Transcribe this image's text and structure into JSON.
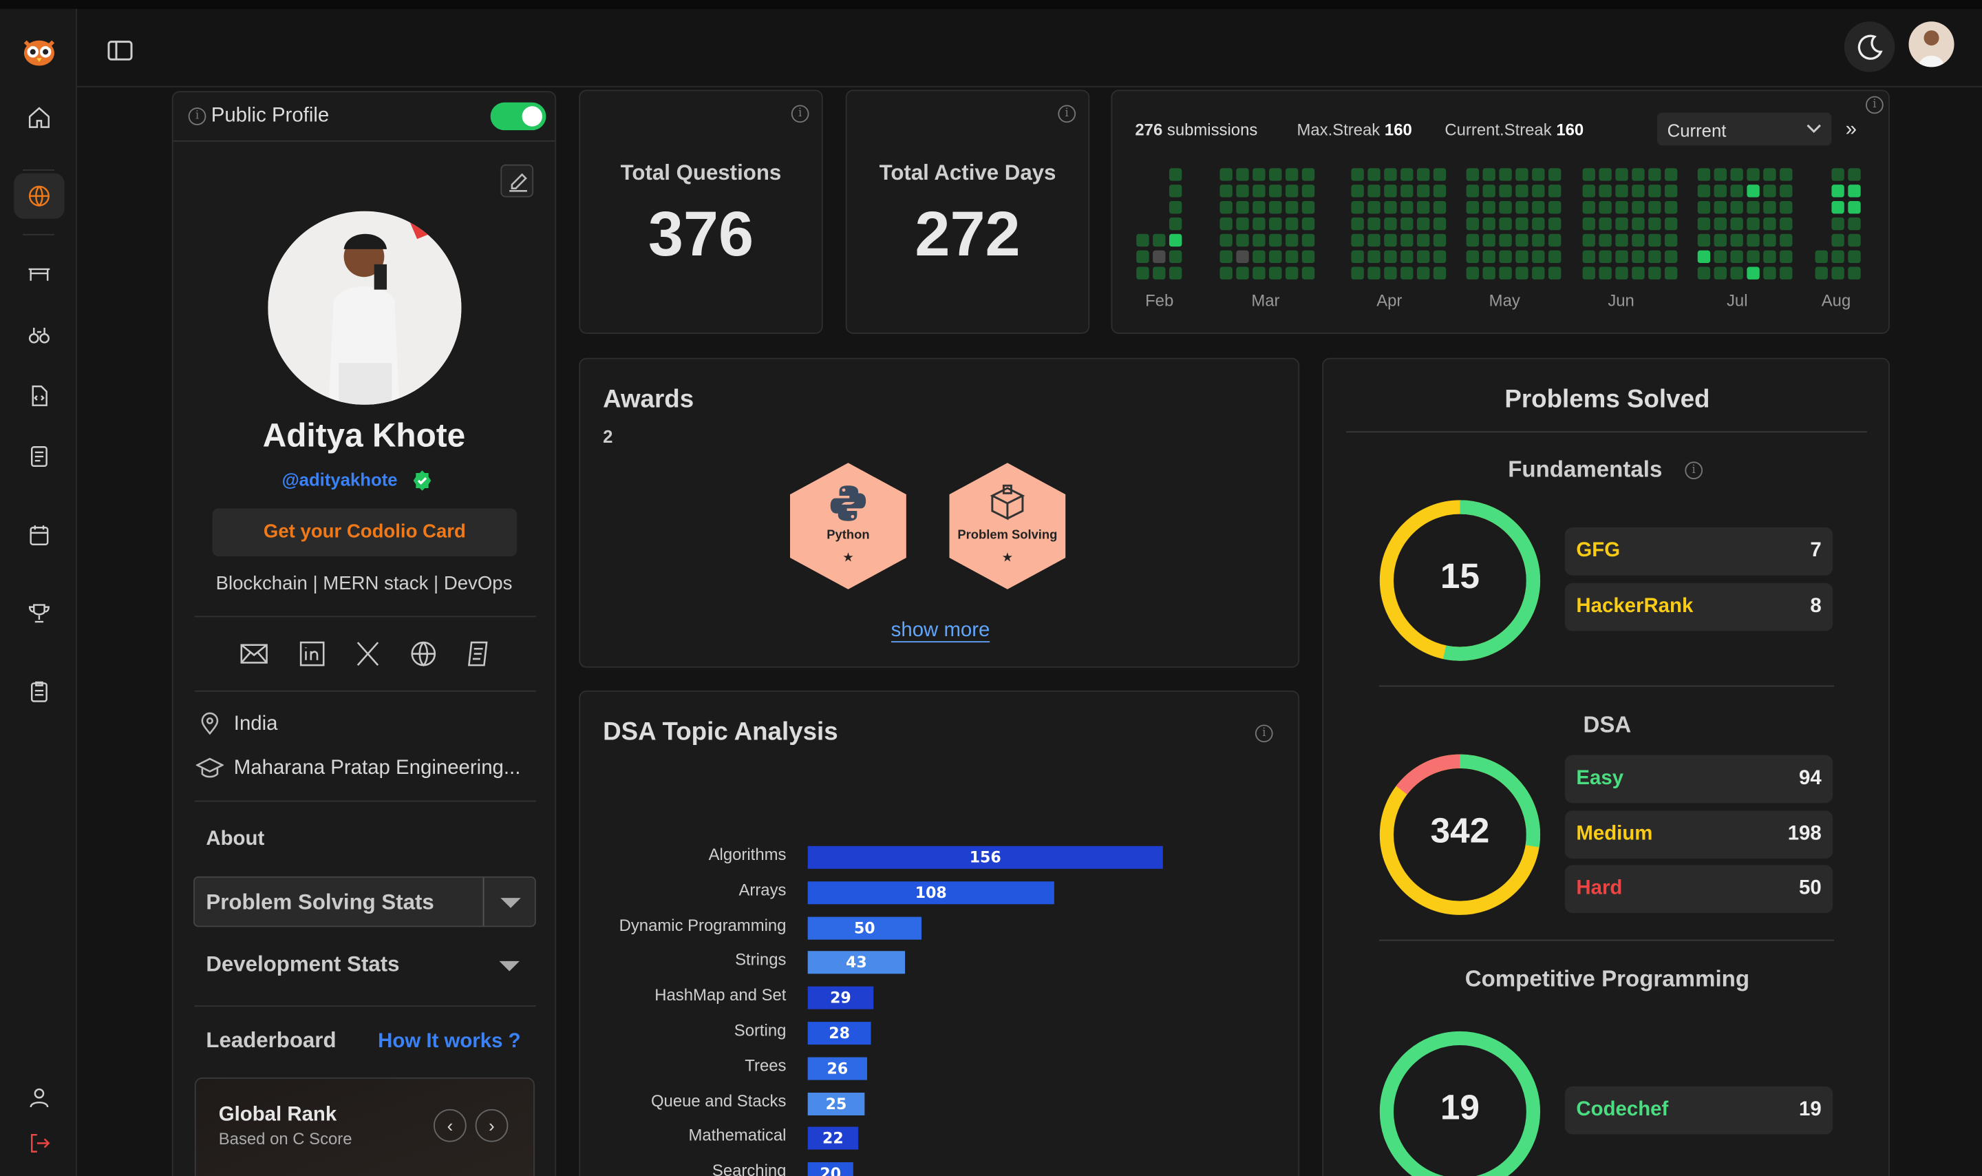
{
  "header": {},
  "sidebar": {
    "items": [
      "home",
      "globe",
      "desk",
      "binoculars",
      "code-file",
      "notes",
      "calendar",
      "trophy",
      "clipboard",
      "user",
      "logout"
    ]
  },
  "profile": {
    "public_label": "Public Profile",
    "name": "Aditya Khote",
    "handle": "@adityakhote",
    "card_button": "Get your Codolio Card",
    "bio": "Blockchain | MERN stack | DevOps",
    "location": "India",
    "college": "Maharana Pratap Engineering...",
    "about": "About",
    "problem_stats": "Problem Solving Stats",
    "dev_stats": "Development Stats",
    "leaderboard": "Leaderboard",
    "how_it_works": "How It works ?",
    "global_rank": "Global Rank",
    "based_on": "Based on C Score"
  },
  "stats": {
    "total_questions_label": "Total Questions",
    "total_questions": "376",
    "active_days_label": "Total Active Days",
    "active_days": "272"
  },
  "heatmap": {
    "submissions_count": "276",
    "submissions_label": "submissions",
    "max_streak_label": "Max.Streak",
    "max_streak": "160",
    "current_streak_label": "Current.Streak",
    "current_streak": "160",
    "select_value": "Current",
    "months": [
      "Feb",
      "Mar",
      "Apr",
      "May",
      "Jun",
      "Jul",
      "Aug"
    ]
  },
  "awards": {
    "title": "Awards",
    "count": "2",
    "badges": [
      {
        "label": "Python",
        "star": "★"
      },
      {
        "label": "Problem Solving",
        "star": "★"
      }
    ],
    "show_more": "show more"
  },
  "dsa_topics": {
    "title": "DSA Topic Analysis"
  },
  "chart_data": {
    "type": "bar",
    "orientation": "horizontal",
    "title": "DSA Topic Analysis",
    "categories": [
      "Algorithms",
      "Arrays",
      "Dynamic Programming",
      "Strings",
      "HashMap and Set",
      "Sorting",
      "Trees",
      "Queue and Stacks",
      "Mathematical",
      "Searching"
    ],
    "values": [
      156,
      108,
      50,
      43,
      29,
      28,
      26,
      25,
      22,
      20
    ],
    "colors": [
      "#1e3fd0",
      "#2357e0",
      "#2f6ae6",
      "#4a8ae8",
      "#1e3fd0",
      "#2357e0",
      "#2f6ae6",
      "#4a8ae8",
      "#1e3fd0",
      "#2357e0"
    ]
  },
  "problems": {
    "title": "Problems Solved",
    "fundamentals": {
      "title": "Fundamentals",
      "total": "15",
      "items": [
        {
          "name": "GFG",
          "value": "7",
          "color": "#facc15"
        },
        {
          "name": "HackerRank",
          "value": "8",
          "color": "#facc15"
        }
      ]
    },
    "dsa": {
      "title": "DSA",
      "total": "342",
      "items": [
        {
          "name": "Easy",
          "value": "94",
          "color": "#4ade80"
        },
        {
          "name": "Medium",
          "value": "198",
          "color": "#facc15"
        },
        {
          "name": "Hard",
          "value": "50",
          "color": "#ef4444"
        }
      ]
    },
    "cp": {
      "title": "Competitive Programming",
      "total": "19",
      "items": [
        {
          "name": "Codechef",
          "value": "19",
          "color": "#4ade80"
        }
      ]
    }
  },
  "colors": {
    "accent": "#f07a1a",
    "green": "#22c55e",
    "link": "#3b82f6"
  }
}
